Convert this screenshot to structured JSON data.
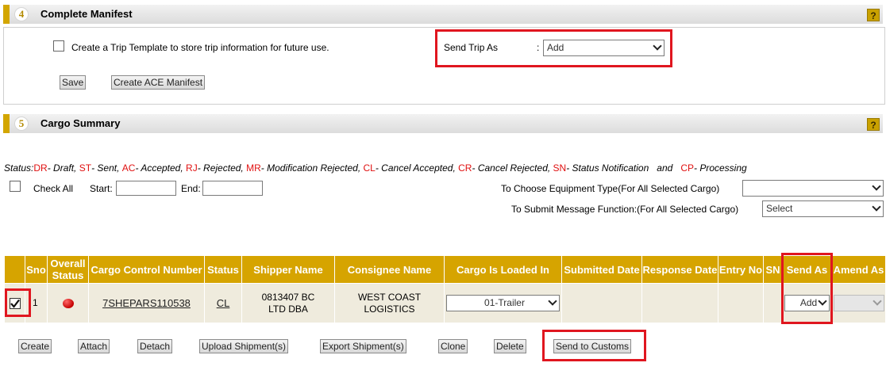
{
  "section4": {
    "number": "4",
    "title": "Complete Manifest",
    "help": "?",
    "template_label": "Create a Trip Template to store trip information for future use.",
    "send_trip_label": "Send Trip As",
    "colon": ":",
    "send_trip_value": "Add",
    "save_label": "Save",
    "create_ace_label": "Create ACE Manifest"
  },
  "section5": {
    "number": "5",
    "title": "Cargo Summary",
    "help": "?",
    "status": {
      "prefix": "Status:",
      "items": [
        {
          "code": "DR",
          "text": "- Draft,"
        },
        {
          "code": "ST",
          "text": "- Sent,"
        },
        {
          "code": "AC",
          "text": "- Accepted,"
        },
        {
          "code": "RJ",
          "text": "- Rejected,"
        },
        {
          "code": "MR",
          "text": "- Modification Rejected,"
        },
        {
          "code": "CL",
          "text": "- Cancel Accepted,"
        },
        {
          "code": "CR",
          "text": "- Cancel Rejected,"
        },
        {
          "code": "SN",
          "text": "- Status Notification"
        },
        {
          "code": "CP",
          "text": "- Processing"
        }
      ],
      "and": "and"
    },
    "check_all_label": "Check All",
    "start_label": "Start:",
    "end_label": "End:",
    "equipment_label": "To Choose Equipment Type(For All Selected Cargo)",
    "equipment_value": "",
    "message_label": "To Submit Message Function:(For All Selected Cargo)",
    "message_value": "Select",
    "table": {
      "headers": {
        "sno": "Sno",
        "overall": "Overall Status",
        "ccn": "Cargo Control Number",
        "status": "Status",
        "shipper": "Shipper Name",
        "consignee": "Consignee Name",
        "loaded": "Cargo Is Loaded In",
        "submitted": "Submitted Date",
        "response": "Response Date",
        "entry": "Entry No",
        "sn": "SN",
        "send_as": "Send As",
        "amend_as": "Amend As"
      },
      "row": {
        "sno": "1",
        "ccn": "7SHEPARS110538",
        "status": "CL",
        "shipper": "0813407 BC LTD DBA",
        "consignee": "WEST COAST LOGISTICS",
        "loaded": "01-Trailer",
        "submitted": "",
        "response": "",
        "entry": "",
        "sn": "",
        "send_as": "Add",
        "amend_as": ""
      }
    },
    "buttons": {
      "create": "Create",
      "attach": "Attach",
      "detach": "Detach",
      "upload": "Upload Shipment(s)",
      "export": "Export Shipment(s)",
      "clone": "Clone",
      "delete": "Delete",
      "send": "Send to Customs"
    }
  },
  "colors": {
    "accent_gold": "#d6a400",
    "highlight_red": "#e0161f",
    "status_red": "#e01010",
    "row_bg": "#efebdd"
  }
}
